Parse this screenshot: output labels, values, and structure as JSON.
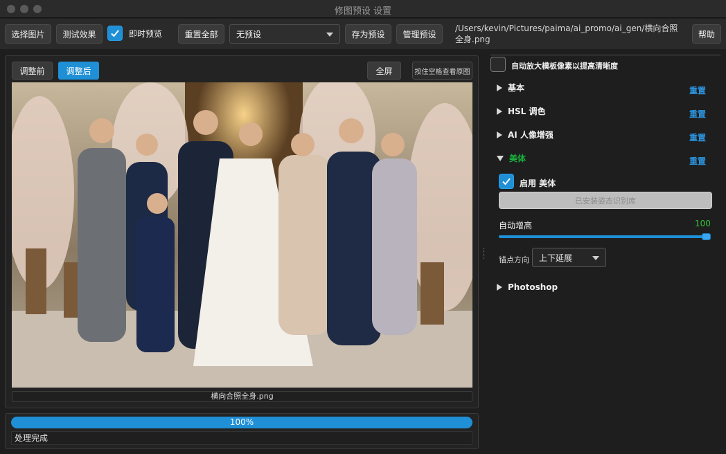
{
  "window": {
    "title": "修图预设 设置"
  },
  "toolbar": {
    "select_image": "选择图片",
    "test_effect": "测试效果",
    "live_preview": "即时预览",
    "reset_all": "重置全部",
    "preset_select": "无预设",
    "save_preset": "存为预设",
    "manage_preset": "管理预设",
    "file_path": "/Users/kevin/Pictures/paima/ai_promo/ai_gen/横向合照全身.png",
    "help": "帮助"
  },
  "preview": {
    "tab_before": "调整前",
    "tab_after": "调整后",
    "fullscreen": "全屏",
    "hold_space": "按住空格查看原图",
    "caption": "横向合照全身.png"
  },
  "progress": {
    "percent_text": "100%",
    "value": 1.0,
    "status": "处理完成"
  },
  "settings": {
    "auto_upscale": "自动放大模板像素以提高清晰度",
    "reset_label": "重置",
    "sections": {
      "basic": "基本",
      "hsl": "HSL 调色",
      "ai_portrait": "AI 人像增强",
      "body": "美体",
      "photoshop": "Photoshop"
    },
    "body": {
      "enable": "启用 美体",
      "pose_lib": "已安装姿态识别库",
      "auto_height": "自动增高",
      "auto_height_value": "100",
      "anchor_label": "锚点方向",
      "anchor_value": "上下延展"
    }
  },
  "colors": {
    "accent": "#1f8fd6",
    "link": "#2b95e0",
    "active_section": "#19b13c",
    "value_green": "#35c23a"
  }
}
